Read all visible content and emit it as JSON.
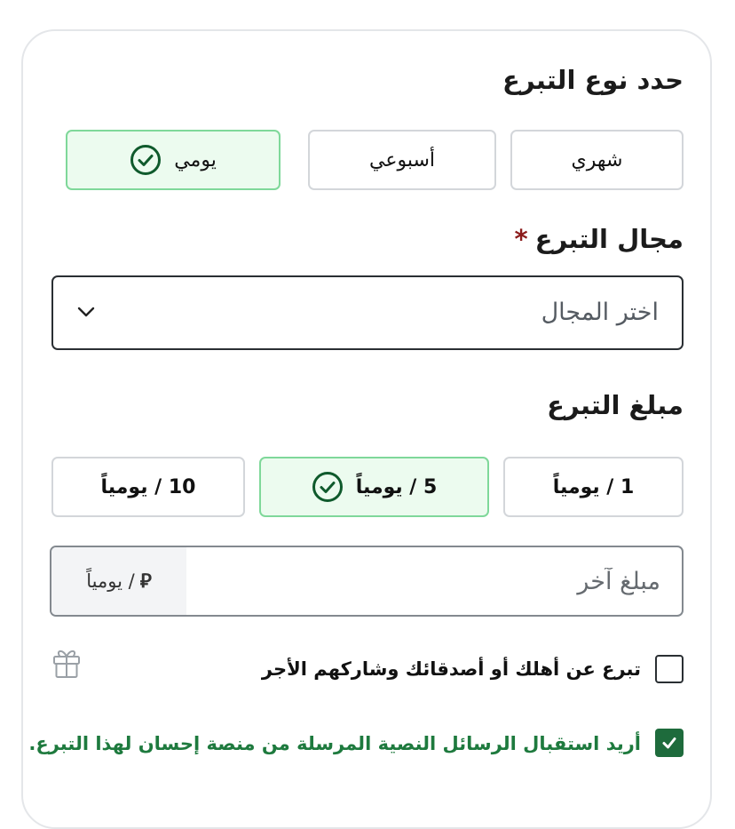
{
  "donation_type": {
    "heading": "حدد نوع التبرع",
    "options": [
      {
        "label": "شهري",
        "selected": false
      },
      {
        "label": "أسبوعي",
        "selected": false
      },
      {
        "label": "يومي",
        "selected": true
      }
    ]
  },
  "donation_field": {
    "heading": "مجال التبرع",
    "required_mark": "*",
    "placeholder": "اختر المجال"
  },
  "donation_amount": {
    "heading": "مبلغ التبرع",
    "options": [
      {
        "label": "1 / يومياً",
        "selected": false
      },
      {
        "label": "5 / يومياً",
        "selected": true
      },
      {
        "label": "10 / يومياً",
        "selected": false
      }
    ],
    "other_placeholder": "مبلغ آخر",
    "currency_symbol": "⃁",
    "unit_label": "/ يومياً"
  },
  "gift_option": {
    "label": "تبرع عن أهلك أو أصدقائك وشاركهم الأجر",
    "checked": false
  },
  "sms_option": {
    "label": "أريد استقبال الرسائل النصية المرسلة من منصة إحسان لهذا التبرع.",
    "checked": true
  },
  "colors": {
    "selected_bg": "#ecfbef",
    "selected_border": "#7fd89a",
    "accent_green": "#1e6b3c",
    "sms_text": "#1e7a3e",
    "required_red": "#8b1a1a"
  },
  "icons": {
    "selected_check": "check-circle-icon",
    "select_arrow": "chevron-down-icon",
    "gift": "gift-icon",
    "checkbox_tick": "checkmark-icon"
  }
}
